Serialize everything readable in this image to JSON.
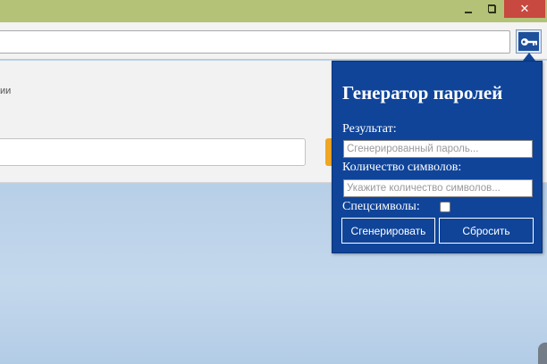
{
  "window": {
    "minimize_icon": "minimize-icon",
    "maximize_icon": "restore-icon",
    "close_glyph": "✕",
    "titlebar_color": "#b4c278"
  },
  "toolbar": {
    "extension_icon": "key-icon",
    "extension_color": "#1d4f9b"
  },
  "page": {
    "text_fragment": "ии"
  },
  "popup": {
    "title": "Генератор паролей",
    "result_label": "Результат:",
    "result_placeholder": "Сгенерированный пароль...",
    "length_label": "Количество символов:",
    "length_placeholder": "Укажите количество символов...",
    "special_label": "Спецсимволы:",
    "special_checked": false,
    "generate_label": "Сгенерировать",
    "reset_label": "Сбросить",
    "background_color": "#0f4499"
  }
}
